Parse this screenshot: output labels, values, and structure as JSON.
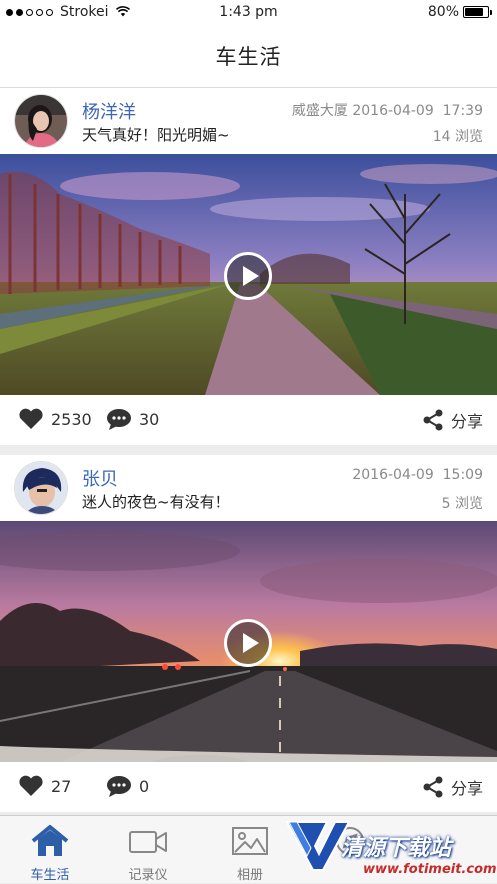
{
  "status_bar": {
    "carrier": "Strokei",
    "time": "1:43 pm",
    "battery": "80%",
    "battery_level": 0.8
  },
  "nav": {
    "title": "车生活"
  },
  "posts": [
    {
      "username": "杨洋洋",
      "location": "威盛大厦",
      "date": "2016-04-09",
      "time": "17:39",
      "caption": "天气真好！阳光明媚~",
      "views": "14 浏览",
      "likes": "2530",
      "comments": "30",
      "share_label": "分享"
    },
    {
      "username": "张贝",
      "location": "",
      "date": "2016-04-09",
      "time": "15:09",
      "caption": "迷人的夜色~有没有！",
      "views": "5 浏览",
      "likes": "27",
      "comments": "0",
      "share_label": "分享"
    }
  ],
  "tabs": [
    {
      "label": "车生活",
      "icon": "home-icon",
      "active": true
    },
    {
      "label": "记录仪",
      "icon": "video-camera-icon",
      "active": false
    },
    {
      "label": "相册",
      "icon": "photo-icon",
      "active": false
    },
    {
      "label": "",
      "icon": "compass-icon",
      "active": false
    }
  ],
  "watermark": {
    "text": "清源下载站",
    "url": "www.fotimeit.com"
  },
  "colors": {
    "accent": "#2d5ea8",
    "username": "#3e65b7",
    "meta": "#8a8a8a"
  }
}
